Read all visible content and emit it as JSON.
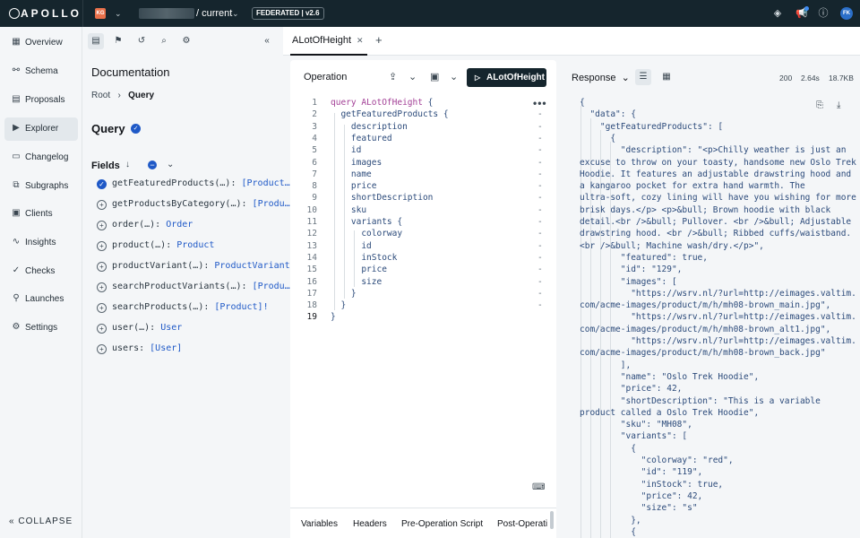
{
  "topbar": {
    "logo": "APOLLO",
    "org_badge": "KG",
    "variant": "/ current",
    "federation": "FEDERATED | v2.6"
  },
  "sidebar": {
    "items": [
      {
        "label": "Overview",
        "icon": "grid-icon"
      },
      {
        "label": "Schema",
        "icon": "schema-icon"
      },
      {
        "label": "Proposals",
        "icon": "proposals-icon"
      },
      {
        "label": "Explorer",
        "icon": "explorer-icon",
        "active": true
      },
      {
        "label": "Changelog",
        "icon": "changelog-icon"
      },
      {
        "label": "Subgraphs",
        "icon": "subgraphs-icon"
      },
      {
        "label": "Clients",
        "icon": "clients-icon"
      },
      {
        "label": "Insights",
        "icon": "insights-icon"
      },
      {
        "label": "Checks",
        "icon": "checks-icon"
      },
      {
        "label": "Launches",
        "icon": "launches-icon"
      },
      {
        "label": "Settings",
        "icon": "gear-icon"
      }
    ],
    "collapse_label": "COLLAPSE"
  },
  "docs": {
    "title": "Documentation",
    "breadcrumb_root": "Root",
    "breadcrumb_current": "Query",
    "type_title": "Query",
    "fields_title": "Fields",
    "fields": [
      {
        "name": "getFeaturedProducts(…): ",
        "type": "[Product…",
        "selected": true
      },
      {
        "name": "getProductsByCategory(…): ",
        "type": "[Produ…",
        "selected": false
      },
      {
        "name": "order(…): ",
        "type": "Order",
        "selected": false
      },
      {
        "name": "product(…): ",
        "type": "Product",
        "selected": false
      },
      {
        "name": "productVariant(…): ",
        "type": "ProductVariant",
        "selected": false
      },
      {
        "name": "searchProductVariants(…): ",
        "type": "[Produ…",
        "selected": false
      },
      {
        "name": "searchProducts(…): ",
        "type": "[Product]!",
        "selected": false
      },
      {
        "name": "user(…): ",
        "type": "User",
        "selected": false
      },
      {
        "name": "users: ",
        "type": "[User]",
        "selected": false
      }
    ]
  },
  "tabs": {
    "operation_tab": "ALotOfHeight"
  },
  "operation": {
    "header": "Operation",
    "run_label": "ALotOfHeight",
    "lines": [
      {
        "n": "1",
        "kw": "query ALotOfHeight",
        "rest": " {",
        "dash": ""
      },
      {
        "n": "2",
        "kw": "",
        "rest": "  getFeaturedProducts {",
        "dash": "-"
      },
      {
        "n": "3",
        "kw": "",
        "rest": "    description",
        "dash": "-"
      },
      {
        "n": "4",
        "kw": "",
        "rest": "    featured",
        "dash": "-"
      },
      {
        "n": "5",
        "kw": "",
        "rest": "    id",
        "dash": "-"
      },
      {
        "n": "6",
        "kw": "",
        "rest": "    images",
        "dash": "-"
      },
      {
        "n": "7",
        "kw": "",
        "rest": "    name",
        "dash": "-"
      },
      {
        "n": "8",
        "kw": "",
        "rest": "    price",
        "dash": "-"
      },
      {
        "n": "9",
        "kw": "",
        "rest": "    shortDescription",
        "dash": "-"
      },
      {
        "n": "10",
        "kw": "",
        "rest": "    sku",
        "dash": "-"
      },
      {
        "n": "11",
        "kw": "",
        "rest": "    variants {",
        "dash": "-"
      },
      {
        "n": "12",
        "kw": "",
        "rest": "      colorway",
        "dash": "-"
      },
      {
        "n": "13",
        "kw": "",
        "rest": "      id",
        "dash": "-"
      },
      {
        "n": "14",
        "kw": "",
        "rest": "      inStock",
        "dash": "-"
      },
      {
        "n": "15",
        "kw": "",
        "rest": "      price",
        "dash": "-"
      },
      {
        "n": "16",
        "kw": "",
        "rest": "      size",
        "dash": "-"
      },
      {
        "n": "17",
        "kw": "",
        "rest": "    }",
        "dash": "-"
      },
      {
        "n": "18",
        "kw": "",
        "rest": "  }",
        "dash": "-"
      },
      {
        "n": "19",
        "kw": "",
        "rest": "}",
        "dash": ""
      }
    ],
    "footer_tabs": [
      "Variables",
      "Headers",
      "Pre-Operation Script",
      "Post-Operati"
    ]
  },
  "response": {
    "header": "Response",
    "status": "200",
    "time": "2.64s",
    "size": "18.7KB",
    "lines": [
      "{",
      "  \"data\": {",
      "    \"getFeaturedProducts\": [",
      "      {",
      "        \"description\": \"<p>Chilly weather is just an",
      "excuse to throw on your toasty, handsome new Oslo Trek",
      "Hoodie. It features an adjustable drawstring hood and",
      "a kangaroo pocket for extra hand warmth. The",
      "ultra-soft, cozy lining will have you wishing for more",
      "brisk days.</p> <p>&bull; Brown hoodie with black",
      "detail.<br />&bull; Pullover. <br />&bull; Adjustable",
      "drawstring hood. <br />&bull; Ribbed cuffs/waistband.",
      "<br />&bull; Machine wash/dry.</p>\",",
      "        \"featured\": true,",
      "        \"id\": \"129\",",
      "        \"images\": [",
      "          \"https://wsrv.nl/?url=http://eimages.valtim.",
      "com/acme-images/product/m/h/mh08-brown_main.jpg\",",
      "          \"https://wsrv.nl/?url=http://eimages.valtim.",
      "com/acme-images/product/m/h/mh08-brown_alt1.jpg\",",
      "          \"https://wsrv.nl/?url=http://eimages.valtim.",
      "com/acme-images/product/m/h/mh08-brown_back.jpg\"",
      "        ],",
      "        \"name\": \"Oslo Trek Hoodie\",",
      "        \"price\": 42,",
      "        \"shortDescription\": \"This is a variable",
      "product called a Oslo Trek Hoodie\",",
      "        \"sku\": \"MH08\",",
      "        \"variants\": [",
      "          {",
      "            \"colorway\": \"red\",",
      "            \"id\": \"119\",",
      "            \"inStock\": true,",
      "            \"price\": 42,",
      "            \"size\": \"s\"",
      "          },",
      "          {"
    ]
  }
}
